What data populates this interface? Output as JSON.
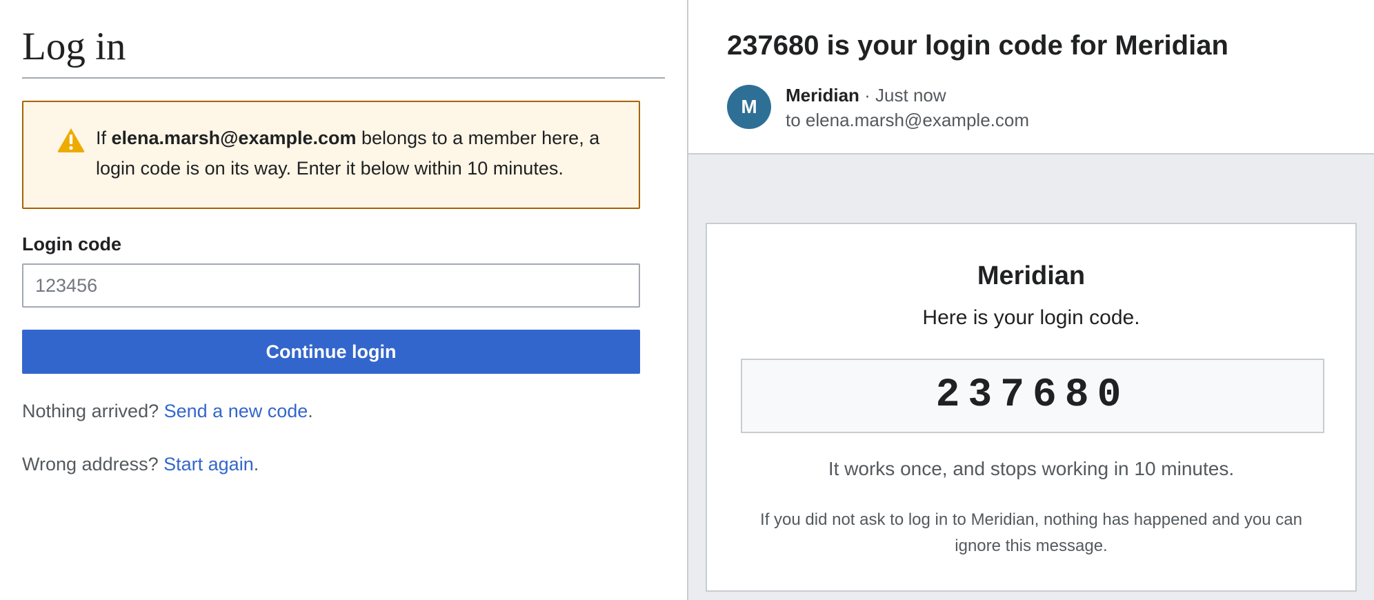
{
  "login": {
    "title": "Log in",
    "notice": {
      "icon": "warning-triangle-icon",
      "prefix": "If ",
      "email": "elena.marsh@example.com",
      "suffix": " belongs to a member here, a login code is on its way. Enter it below within 10 minutes."
    },
    "code_label": "Login code",
    "code_value": "",
    "code_placeholder": "123456",
    "continue_label": "Continue login",
    "resend": {
      "prefix": "Nothing arrived? ",
      "link": "Send a new code",
      "suffix": "."
    },
    "restart": {
      "prefix": "Wrong address? ",
      "link": "Start again",
      "suffix": "."
    }
  },
  "email": {
    "subject": "237680 is your login code for Meridian",
    "avatar_letter": "M",
    "sender": "Meridian",
    "time_separator": " · ",
    "time": "Just now",
    "recipient": "to elena.marsh@example.com",
    "body": {
      "brand": "Meridian",
      "intro": "Here is your login code.",
      "code": "237680",
      "expiry": "It works once, and stops working in 10 minutes.",
      "disclaimer": "If you did not ask to log in to Meridian, nothing has happened and you can ignore this message."
    }
  },
  "colors": {
    "accent": "#3366cc",
    "warning_background": "#fef6e7",
    "warning_border": "#a66200",
    "warning_icon": "#edab00",
    "avatar": "#2e6f96",
    "email_background": "#eaecf0"
  }
}
